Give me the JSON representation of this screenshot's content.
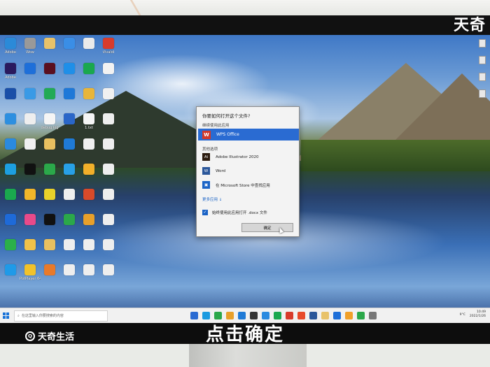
{
  "brand": {
    "watermark_top": "天奇",
    "watermark_bottom": "天奇生活"
  },
  "caption": "点击确定",
  "dialog": {
    "title": "你要如何打开这个文件?",
    "subtitle": "继续使用此应用",
    "default_app": "WPS Office",
    "other_options_label": "其他选项",
    "apps": [
      {
        "name": "Adobe Illustrator 2020",
        "icon": "illustrator-icon",
        "color": "#2b1b0e",
        "glyph": "Ai"
      },
      {
        "name": "Word",
        "icon": "word-icon",
        "color": "#2b579a",
        "glyph": "W"
      },
      {
        "name": "在 Microsoft Store 中查找应用",
        "icon": "store-icon",
        "color": "#1a63c6",
        "glyph": "▣"
      }
    ],
    "more_apps": "更多应用 ↓",
    "always_use": "始终使用此应用打开 .docx 文件",
    "ok_button": "确定"
  },
  "desktop_icons": [
    {
      "label": "Adobe",
      "color": "#2b8ad8"
    },
    {
      "label": "Wow",
      "color": "#999"
    },
    {
      "label": "",
      "color": "#e8c26a"
    },
    {
      "label": "",
      "color": "#3a8ee6"
    },
    {
      "label": "",
      "color": "#eaeaea"
    },
    {
      "label": "Vivaldi",
      "color": "#d83b2b"
    },
    {
      "label": "Adobe",
      "color": "#2a1a5e"
    },
    {
      "label": "",
      "color": "#1e6fd9"
    },
    {
      "label": "",
      "color": "#5a1020"
    },
    {
      "label": "",
      "color": "#1f8fe8"
    },
    {
      "label": "",
      "color": "#1aa84e"
    },
    {
      "label": "",
      "color": "#f2f2f2"
    },
    {
      "label": "",
      "color": "#1a4fa8"
    },
    {
      "label": "",
      "color": "#3a9ae6"
    },
    {
      "label": "",
      "color": "#22aa55"
    },
    {
      "label": "",
      "color": "#1e78d8"
    },
    {
      "label": "",
      "color": "#e8b53a"
    },
    {
      "label": "",
      "color": "#f0f0f0"
    },
    {
      "label": "",
      "color": "#2d8fe0"
    },
    {
      "label": "",
      "color": "#eee"
    },
    {
      "label": "debug.log",
      "color": "#f5f5f5"
    },
    {
      "label": "",
      "color": "#2a66c8"
    },
    {
      "label": "1.txt",
      "color": "#f5f5f5"
    },
    {
      "label": "",
      "color": "#eee"
    },
    {
      "label": "",
      "color": "#2a8ae0"
    },
    {
      "label": "",
      "color": "#f0f0f0"
    },
    {
      "label": "",
      "color": "#e8c060"
    },
    {
      "label": "",
      "color": "#1f7ad6"
    },
    {
      "label": "",
      "color": "#f0f0f0"
    },
    {
      "label": "",
      "color": "#eee"
    },
    {
      "label": "",
      "color": "#1d9fe0"
    },
    {
      "label": "",
      "color": "#111"
    },
    {
      "label": "",
      "color": "#2ba84a"
    },
    {
      "label": "",
      "color": "#28a0e6"
    },
    {
      "label": "",
      "color": "#f2b02a"
    },
    {
      "label": "",
      "color": "#eee"
    },
    {
      "label": "",
      "color": "#1aa84e"
    },
    {
      "label": "",
      "color": "#f0b52a"
    },
    {
      "label": "",
      "color": "#e8d02a"
    },
    {
      "label": "",
      "color": "#eee"
    },
    {
      "label": "",
      "color": "#d84a2a"
    },
    {
      "label": "",
      "color": "#eee"
    },
    {
      "label": "",
      "color": "#1e6ad8"
    },
    {
      "label": "",
      "color": "#e84a8a"
    },
    {
      "label": "",
      "color": "#111"
    },
    {
      "label": "",
      "color": "#2ba84a"
    },
    {
      "label": "",
      "color": "#e8a02a"
    },
    {
      "label": "",
      "color": "#eee"
    },
    {
      "label": "",
      "color": "#2bb04a"
    },
    {
      "label": "",
      "color": "#f0c24a"
    },
    {
      "label": "",
      "color": "#e8c060"
    },
    {
      "label": "",
      "color": "#eee"
    },
    {
      "label": "",
      "color": "#eee"
    },
    {
      "label": "",
      "color": "#eee"
    },
    {
      "label": "",
      "color": "#1f9ae8"
    },
    {
      "label": "PotPlayer 64 bit",
      "color": "#f2c22a"
    },
    {
      "label": "",
      "color": "#e87a2a"
    },
    {
      "label": "",
      "color": "#eee"
    },
    {
      "label": "",
      "color": "#eee"
    },
    {
      "label": "",
      "color": "#eee"
    }
  ],
  "taskbar": {
    "search_placeholder": "在这里输入你要搜索的内容",
    "tray_weather": "9°C",
    "time": "10:49",
    "date": "2022/1/26",
    "apps": [
      "#2a6bd2",
      "#1a9ae0",
      "#2ba84a",
      "#e8a02a",
      "#1f7ad6",
      "#333",
      "#2a8ae0",
      "#1aa84e",
      "#d83b2b",
      "#e84a2a",
      "#2b579a",
      "#e8c26a",
      "#1e6fd9",
      "#f0a02a",
      "#2ba84a",
      "#777"
    ]
  }
}
